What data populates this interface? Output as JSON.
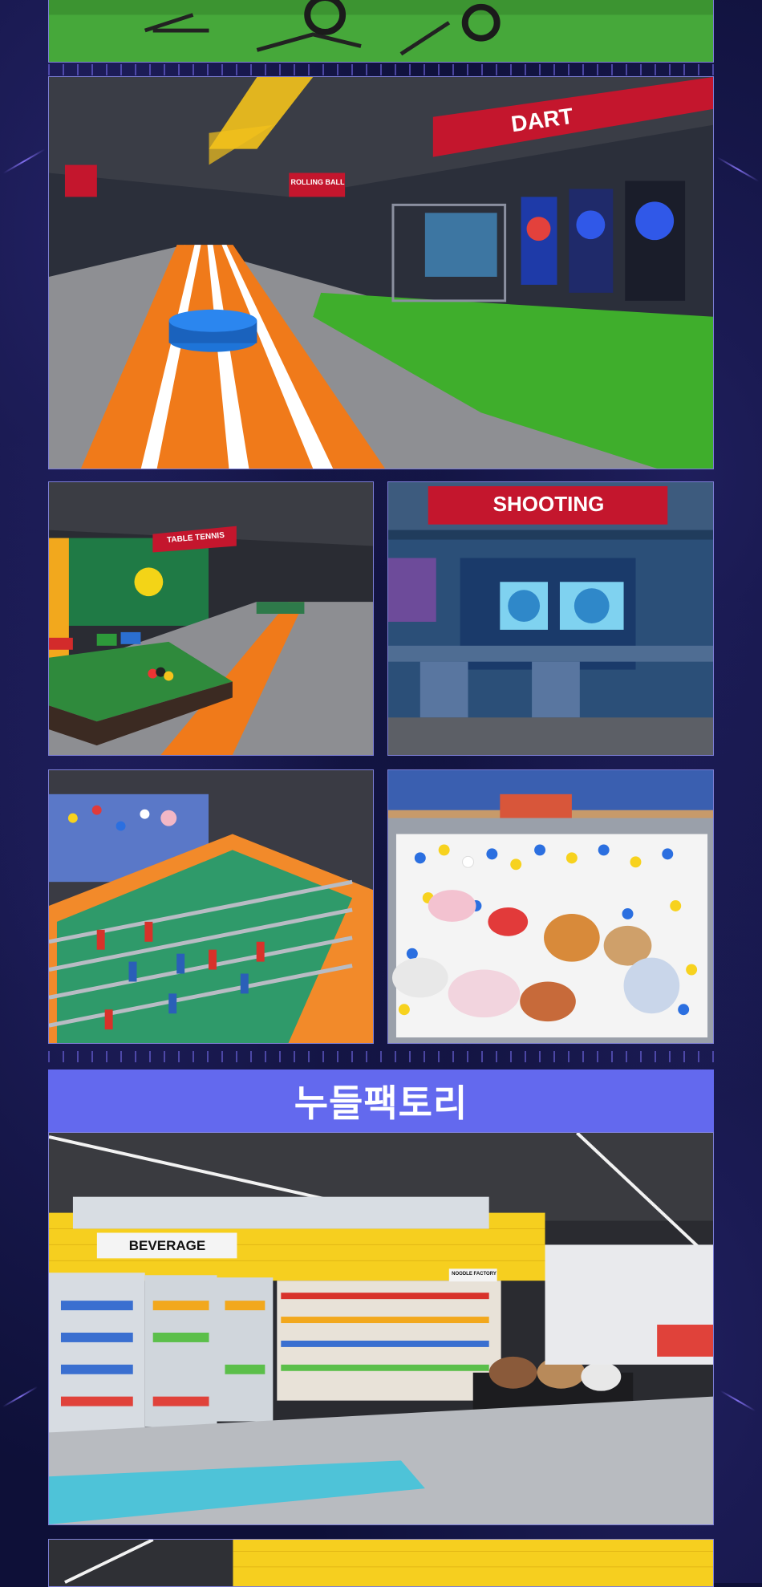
{
  "signs": {
    "dart": "DART",
    "rolling_ball": "ROLLING BALL",
    "table_tennis": "TABLE TENNIS",
    "shooting": "SHOOTING",
    "beverage": "BEVERAGE",
    "noodle_factory": "NOODLE FACTORY"
  },
  "section": {
    "title": "누들팩토리"
  },
  "colors": {
    "background": "#0e1038",
    "title_bar": "#6369ee",
    "sign_red": "#c4162d",
    "turf_green": "#3fae2c",
    "track_orange": "#f07a1a"
  }
}
